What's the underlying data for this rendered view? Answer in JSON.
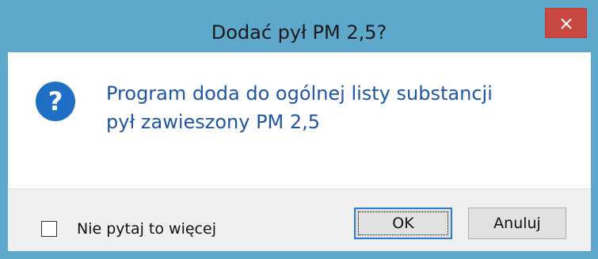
{
  "window": {
    "title": "Dodać pył PM 2,5?",
    "close_label": "close"
  },
  "message": {
    "line1": "Program doda do ogólnej listy substancji",
    "line2": "pył zawieszony PM 2,5",
    "icon": "question-icon"
  },
  "footer": {
    "checkbox_label": "Nie pytaj to więcej",
    "checkbox_checked": false,
    "ok_label": "OK",
    "cancel_label": "Anuluj"
  },
  "colors": {
    "frame": "#5ea9cb",
    "close_button": "#c9483f",
    "message_text": "#1f55a4",
    "icon": "#1f6fc5",
    "default_button_border": "#2b7bd0"
  }
}
